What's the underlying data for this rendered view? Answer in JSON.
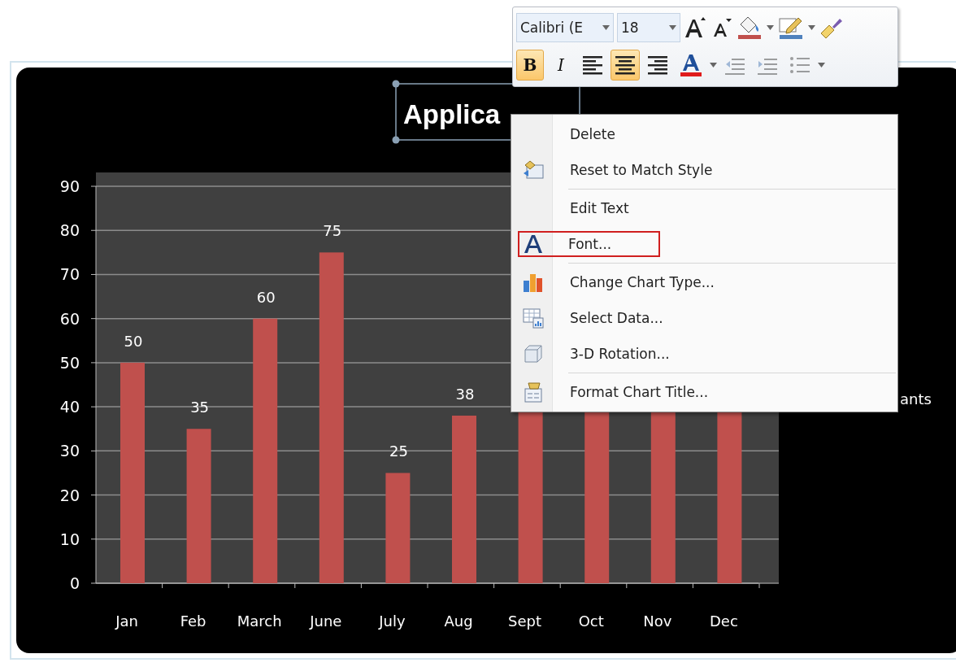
{
  "chart": {
    "title": "Applica",
    "legend": "ants",
    "chart_data": {
      "type": "bar",
      "categories": [
        "Jan",
        "Feb",
        "March",
        "June",
        "July",
        "Aug",
        "Sept",
        "Oct",
        "Nov",
        "Dec"
      ],
      "series": [
        {
          "color": "#c0504d",
          "values": [
            50,
            35,
            60,
            75,
            25,
            38,
            null,
            null,
            null,
            null
          ]
        }
      ],
      "ylim": [
        0,
        90
      ],
      "grid": true,
      "yticks": [
        0,
        10,
        20,
        30,
        40,
        50,
        60,
        70,
        80,
        90
      ],
      "data_labels": true
    }
  },
  "mini_toolbar": {
    "font_name": "Calibri (E",
    "font_size": "18",
    "tools": [
      {
        "kind": "grow-font"
      },
      {
        "kind": "shrink-font"
      },
      {
        "kind": "fill"
      },
      {
        "kind": "outline"
      },
      {
        "kind": "painter"
      }
    ],
    "format_buttons": [
      {
        "kind": "bold",
        "label": "B",
        "selected": true,
        "disabled": false
      },
      {
        "kind": "italic",
        "label": "I",
        "selected": false,
        "disabled": false
      },
      {
        "kind": "align-left",
        "selected": false,
        "disabled": false
      },
      {
        "kind": "align-center",
        "selected": true,
        "disabled": false
      },
      {
        "kind": "align-right",
        "selected": false,
        "disabled": false
      },
      {
        "kind": "font-color",
        "selected": false,
        "disabled": false
      },
      {
        "kind": "decrease-indent",
        "selected": false,
        "disabled": true
      },
      {
        "kind": "increase-indent",
        "selected": false,
        "disabled": true
      },
      {
        "kind": "bullets",
        "selected": false,
        "disabled": true
      }
    ]
  },
  "context_menu": {
    "items": [
      {
        "kind": "plain",
        "label": "Delete",
        "separator_before": false,
        "highlighted": false
      },
      {
        "kind": "reset",
        "label": "Reset to Match Style",
        "separator_before": false,
        "highlighted": false
      },
      {
        "kind": "plain",
        "label": "Edit Text",
        "separator_before": true,
        "highlighted": false
      },
      {
        "kind": "font",
        "label": "Font...",
        "separator_before": false,
        "highlighted": true
      },
      {
        "kind": "chart-type",
        "label": "Change Chart Type...",
        "separator_before": true,
        "highlighted": false
      },
      {
        "kind": "select-data",
        "label": "Select Data...",
        "separator_before": false,
        "highlighted": false
      },
      {
        "kind": "rotation",
        "label": "3-D Rotation...",
        "separator_before": false,
        "highlighted": false
      },
      {
        "kind": "format",
        "label": "Format Chart Title...",
        "separator_before": true,
        "highlighted": false
      }
    ]
  }
}
